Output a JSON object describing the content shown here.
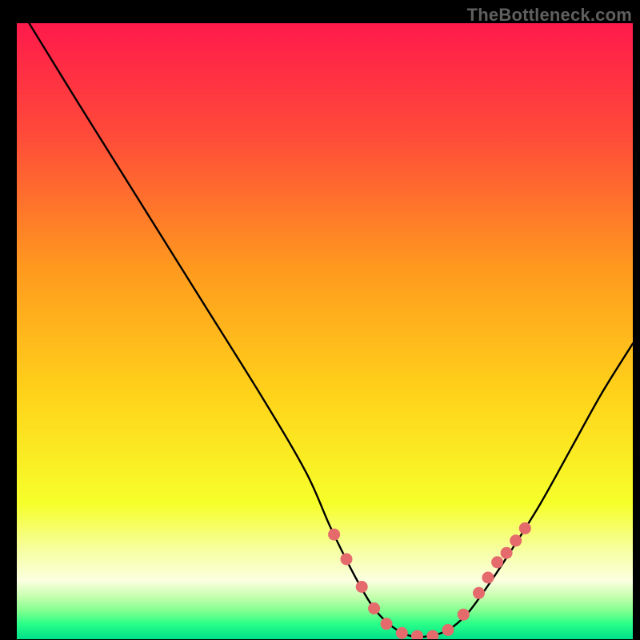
{
  "watermark": "TheBottleneck.com",
  "chart_data": {
    "type": "line",
    "title": "",
    "xlabel": "",
    "ylabel": "",
    "xlim": [
      0,
      100
    ],
    "ylim": [
      0,
      100
    ],
    "series": [
      {
        "name": "curve",
        "x": [
          2,
          10,
          20,
          30,
          40,
          47,
          51,
          55,
          58,
          61,
          64,
          67,
          70,
          73,
          76,
          80,
          85,
          90,
          95,
          100
        ],
        "y": [
          100,
          87,
          71,
          55,
          39,
          27,
          18,
          10,
          5,
          2,
          0.5,
          0.5,
          1.5,
          4,
          8,
          14,
          22,
          31,
          40,
          48
        ]
      }
    ],
    "markers": {
      "name": "dots",
      "x": [
        51.5,
        53.5,
        56,
        58,
        60,
        62.5,
        65,
        67.5,
        70,
        72.5,
        75,
        76.5,
        78,
        79.5,
        81,
        82.5
      ],
      "y": [
        17,
        13,
        8.5,
        5,
        2.5,
        1,
        0.5,
        0.5,
        1.5,
        4,
        7.5,
        10,
        12.5,
        14,
        16,
        18
      ],
      "color": "#e46a6c",
      "size": 7.5
    },
    "gradient_stops": [
      {
        "offset": 0,
        "color": "#ff1a4b"
      },
      {
        "offset": 0.18,
        "color": "#ff4a3a"
      },
      {
        "offset": 0.4,
        "color": "#ff9a1e"
      },
      {
        "offset": 0.6,
        "color": "#ffd21a"
      },
      {
        "offset": 0.78,
        "color": "#f6ff2a"
      },
      {
        "offset": 0.86,
        "color": "#f6ffa8"
      },
      {
        "offset": 0.905,
        "color": "#fcffe0"
      },
      {
        "offset": 0.93,
        "color": "#c8ffb0"
      },
      {
        "offset": 0.955,
        "color": "#7dff8e"
      },
      {
        "offset": 0.975,
        "color": "#2aff88"
      },
      {
        "offset": 1.0,
        "color": "#00e08a"
      }
    ]
  }
}
